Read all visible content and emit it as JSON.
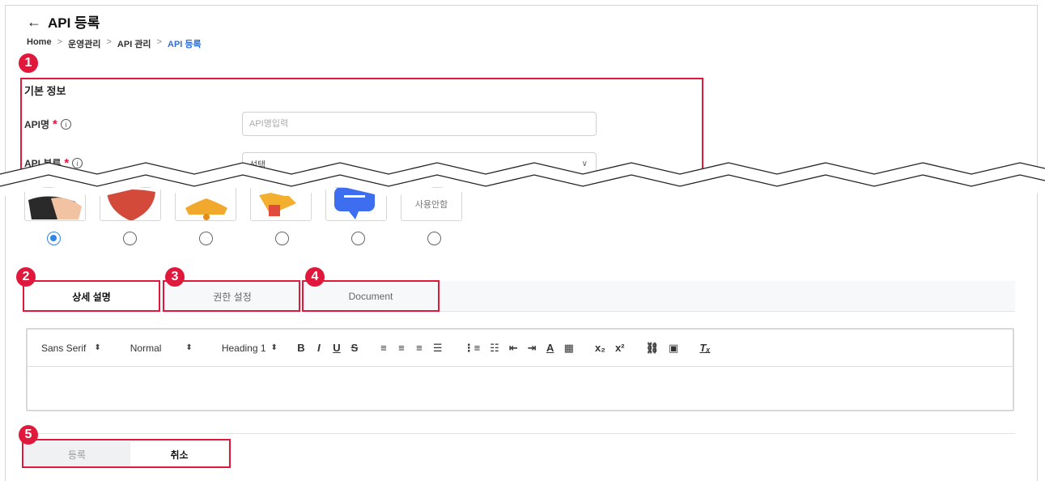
{
  "header": {
    "back_icon": "arrow-left-icon",
    "title": "API 등록"
  },
  "breadcrumb": {
    "items": [
      "Home",
      "운영관리",
      "API 관리",
      "API 등록"
    ],
    "separator": ">"
  },
  "markers": [
    "1",
    "2",
    "3",
    "4",
    "5"
  ],
  "basic_info": {
    "section_title": "기본 정보",
    "api_name_label": "API명",
    "api_name_placeholder": "API명입력",
    "api_category_label": "API 분류",
    "api_category_value": "선택",
    "required_mark": "*",
    "info_glyph": "i"
  },
  "icons": {
    "options": [
      "handshake-icon",
      "heart-icon",
      "bell-icon",
      "megaphone-icon",
      "chat-bubble-icon",
      "사용안함"
    ],
    "selected_index": 0
  },
  "tabs": [
    {
      "label": "상세 설명",
      "active": true
    },
    {
      "label": "권한 설정",
      "active": false
    },
    {
      "label": "Document",
      "active": false
    }
  ],
  "editor": {
    "font_select": "Sans Serif",
    "size_select": "Normal",
    "heading_select": "Heading 1",
    "toolbar_icons": [
      "bold-icon",
      "italic-icon",
      "underline-icon",
      "strike-icon",
      "align-left-icon",
      "align-center-icon",
      "align-right-icon",
      "align-justify-icon",
      "ordered-list-icon",
      "bullet-list-icon",
      "outdent-icon",
      "indent-icon",
      "text-color-icon",
      "background-color-icon",
      "subscript-icon",
      "superscript-icon",
      "link-icon",
      "image-icon",
      "clear-format-icon"
    ],
    "bold": "B",
    "italic": "I",
    "underline": "U",
    "strike": "S",
    "subscript": "x₂",
    "superscript": "x²",
    "clear_format": "Tₓ"
  },
  "actions": {
    "submit_label": "등록",
    "cancel_label": "취소"
  },
  "colors": {
    "accent_red": "#e0183c",
    "link_blue": "#2f6fd6",
    "radio_blue": "#2f86e8"
  }
}
